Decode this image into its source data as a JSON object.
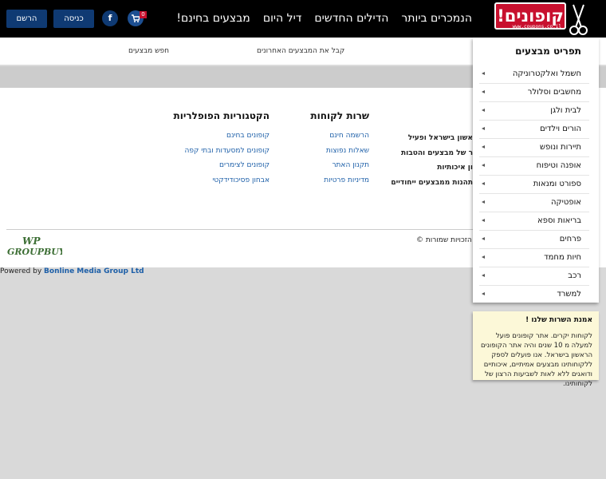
{
  "header": {
    "logo_text": "קופונים!",
    "logo_url": "www.coupons.co.il",
    "nav": [
      "מבצעים בחינם!",
      "דיל היום",
      "הדילים החדשים",
      "הנמכרים ביותר"
    ],
    "cart_count": "0",
    "facebook_glyph": "f",
    "login_label": "כניסה",
    "register_label": "הרשם"
  },
  "subbar": {
    "latest_deals": "קבל את המבצעים האחרונים",
    "search_deals": "חפש מבצעים"
  },
  "footer": {
    "col_customer_service": {
      "title": "שרות לקוחות",
      "links": [
        "הרשמה חינם",
        "שאלות נפוצות",
        "תקנון האתר",
        "מדיניות פרטיות"
      ]
    },
    "col_popular": {
      "title": "הקטגוריות הפופלריות",
      "links": [
        "קופונים בחינם",
        "קופונים למסעדות ובתי קפה",
        "קופונים לצימרים",
        "אבחון פסיכודידקטי"
      ]
    },
    "col_about": {
      "links": [
        "אשון בישראל ופעיל",
        "ר של מבצעים והטבות",
        "ון איכותיות",
        "תהנות ממבצעים ייחודיים"
      ]
    },
    "copyright": "ל הזכויות שמורות ©",
    "partner_logo_text": "WP GROUPBUY",
    "powered_prefix": "Powered by",
    "powered_company": "Bonline Media Group Ltd"
  },
  "categories": {
    "title": "תפריט מבצעים",
    "items": [
      "חשמל ואלקטרוניקה",
      "מחשבים וסלולר",
      "לבית ולגן",
      "הורים וילדים",
      "תיירות ונופש",
      "אופנה וטיפוח",
      "ספורט ומנאות",
      "אופטיקה",
      "בריאות וספא",
      "פרחים",
      "חיות מחמד",
      "רכב",
      "למשרד"
    ]
  },
  "promise": {
    "title": "אמנת השרות שלנו !",
    "body": "לקוחות יקרים. אתר קופונים פועל למעלה מ 10 שנים והיה אתר הקופונים הראשון בישראל. אנו פועלים לספק ללקוחותינו מבצעים אמיתיים, איכותיים ודואגים ללא לאות לשביעות הרצון של לקוחותינו."
  },
  "colors": {
    "brand_red": "#c8102e",
    "brand_blue": "#0f3a73",
    "link_blue": "#1d5fa8"
  }
}
